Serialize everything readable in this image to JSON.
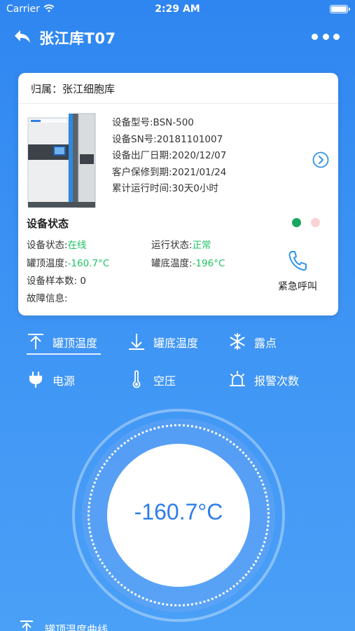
{
  "status_bar": {
    "carrier": "Carrier",
    "time": "2:29 AM"
  },
  "nav": {
    "title": "张江库T07"
  },
  "card": {
    "owner": "归属：张江细胞库",
    "info": [
      "设备型号:BSN-500",
      "设备SN号:20181101007",
      "设备出厂日期:2020/12/07",
      "客户保修到期:2021/01/24",
      "累计运行时间:30天0小时"
    ],
    "state_title": "设备状态",
    "device_status_label": "设备状态:",
    "device_status_value": "在线",
    "run_status_label": "运行状态:",
    "run_status_value": "正常",
    "top_temp_label": "罐顶温度:",
    "top_temp_value": "-160.7°C",
    "bottom_temp_label": "罐底温度:",
    "bottom_temp_value": "-196°C",
    "sample_count": "设备样本数: 0",
    "fault_info": "故障信息:",
    "emergency_call": "紧急呼叫"
  },
  "tabs": [
    {
      "label": "罐顶温度",
      "icon": "arrow-up-icon",
      "active": true
    },
    {
      "label": "罐底温度",
      "icon": "arrow-down-icon",
      "active": false
    },
    {
      "label": "露点",
      "icon": "snowflake-icon",
      "active": false
    },
    {
      "label": "电源",
      "icon": "plug-icon",
      "active": false
    },
    {
      "label": "空压",
      "icon": "thermometer-icon",
      "active": false
    },
    {
      "label": "报警次数",
      "icon": "alarm-icon",
      "active": false
    }
  ],
  "gauge": {
    "value": "-160.7°C"
  },
  "curve": {
    "label": "罐顶温度曲线"
  },
  "colors": {
    "accent": "#2f7de6",
    "status_green": "#1fc265",
    "dot_online": "#1aa860",
    "dot_alarm": "#f9d3d4",
    "background": "#3a8ff2"
  }
}
